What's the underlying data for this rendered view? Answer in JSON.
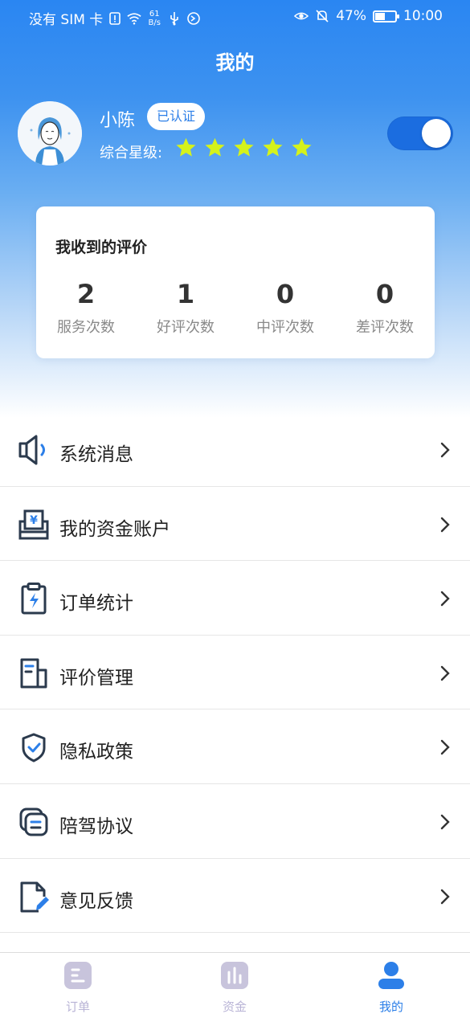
{
  "status_bar": {
    "carrier": "没有 SIM 卡",
    "net_speed_value": "61",
    "net_speed_unit": "B/s",
    "battery": "47%",
    "time": "10:00"
  },
  "header": {
    "title": "我的"
  },
  "profile": {
    "name": "小陈",
    "badge": "已认证",
    "rating_label": "综合星级:",
    "stars": 5,
    "star_color": "#d4f21c",
    "toggle_on": true
  },
  "reviews": {
    "title": "我收到的评价",
    "stats": [
      {
        "value": "2",
        "label": "服务次数"
      },
      {
        "value": "1",
        "label": "好评次数"
      },
      {
        "value": "0",
        "label": "中评次数"
      },
      {
        "value": "0",
        "label": "差评次数"
      }
    ]
  },
  "menu": {
    "items": [
      {
        "label": "系统消息",
        "icon": "speaker-icon"
      },
      {
        "label": "我的资金账户",
        "icon": "wallet-yen-icon"
      },
      {
        "label": "订单统计",
        "icon": "clipboard-bolt-icon"
      },
      {
        "label": "评价管理",
        "icon": "document-icon"
      },
      {
        "label": "隐私政策",
        "icon": "shield-check-icon"
      },
      {
        "label": "陪驾协议",
        "icon": "cards-icon"
      },
      {
        "label": "意见反馈",
        "icon": "file-edit-icon"
      }
    ]
  },
  "tabbar": {
    "tabs": [
      {
        "label": "订单",
        "active": false
      },
      {
        "label": "资金",
        "active": false
      },
      {
        "label": "我的",
        "active": true
      }
    ],
    "active_color": "#2c7fe8",
    "inactive_color": "#b9b4d6"
  }
}
